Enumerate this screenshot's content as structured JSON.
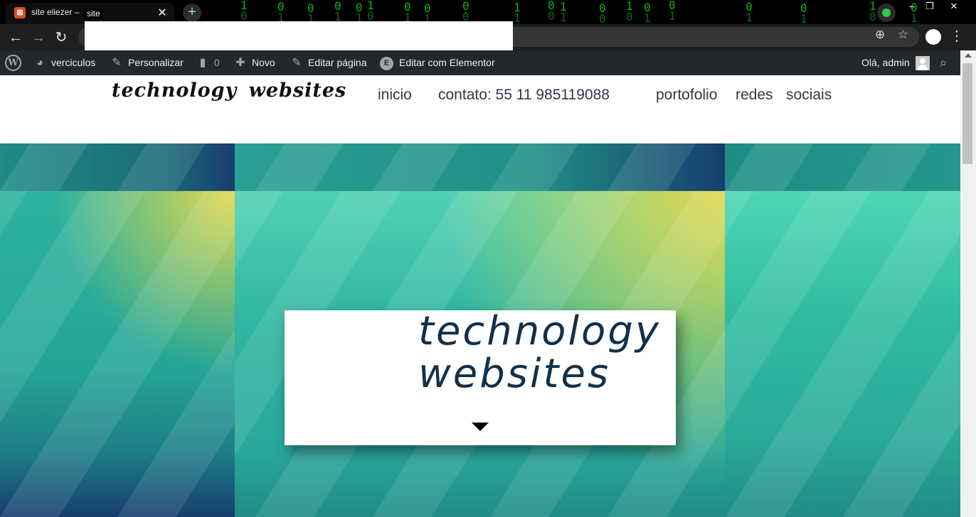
{
  "browser": {
    "tab_title": "site eliezer –",
    "tab_title_overlay": "site",
    "new_tab_symbol": "+",
    "close_symbol": "✕",
    "matrix_digits": "1 0 0 1 0 1 0 1 0 1 1 0 0 1 0 1 0 0 1 1 0 0 1 1 0 0",
    "window_buttons": [
      "–",
      "❐",
      "✕"
    ]
  },
  "adminbar": {
    "site_name": "verciculos",
    "customize": "Personalizar",
    "comments_count": "0",
    "new": "Novo",
    "edit_page": "Editar página",
    "edit_elementor": "Editar com Elementor",
    "elementor_badge": "E",
    "greeting": "Olá, admin"
  },
  "site": {
    "logo": "technology websites",
    "menu": [
      "inicio",
      "contato: 55 11 985119088",
      "portofolio",
      "redes",
      "sociais"
    ]
  },
  "hero": {
    "title_line1": "technology",
    "title_line2": "websites"
  },
  "colors": {
    "adminbar_bg": "#23282d",
    "hero_teal": "#2aa39a",
    "hero_yellow": "#e2d84d",
    "hero_navy": "#173e6e",
    "hero_text": "#12304a"
  }
}
